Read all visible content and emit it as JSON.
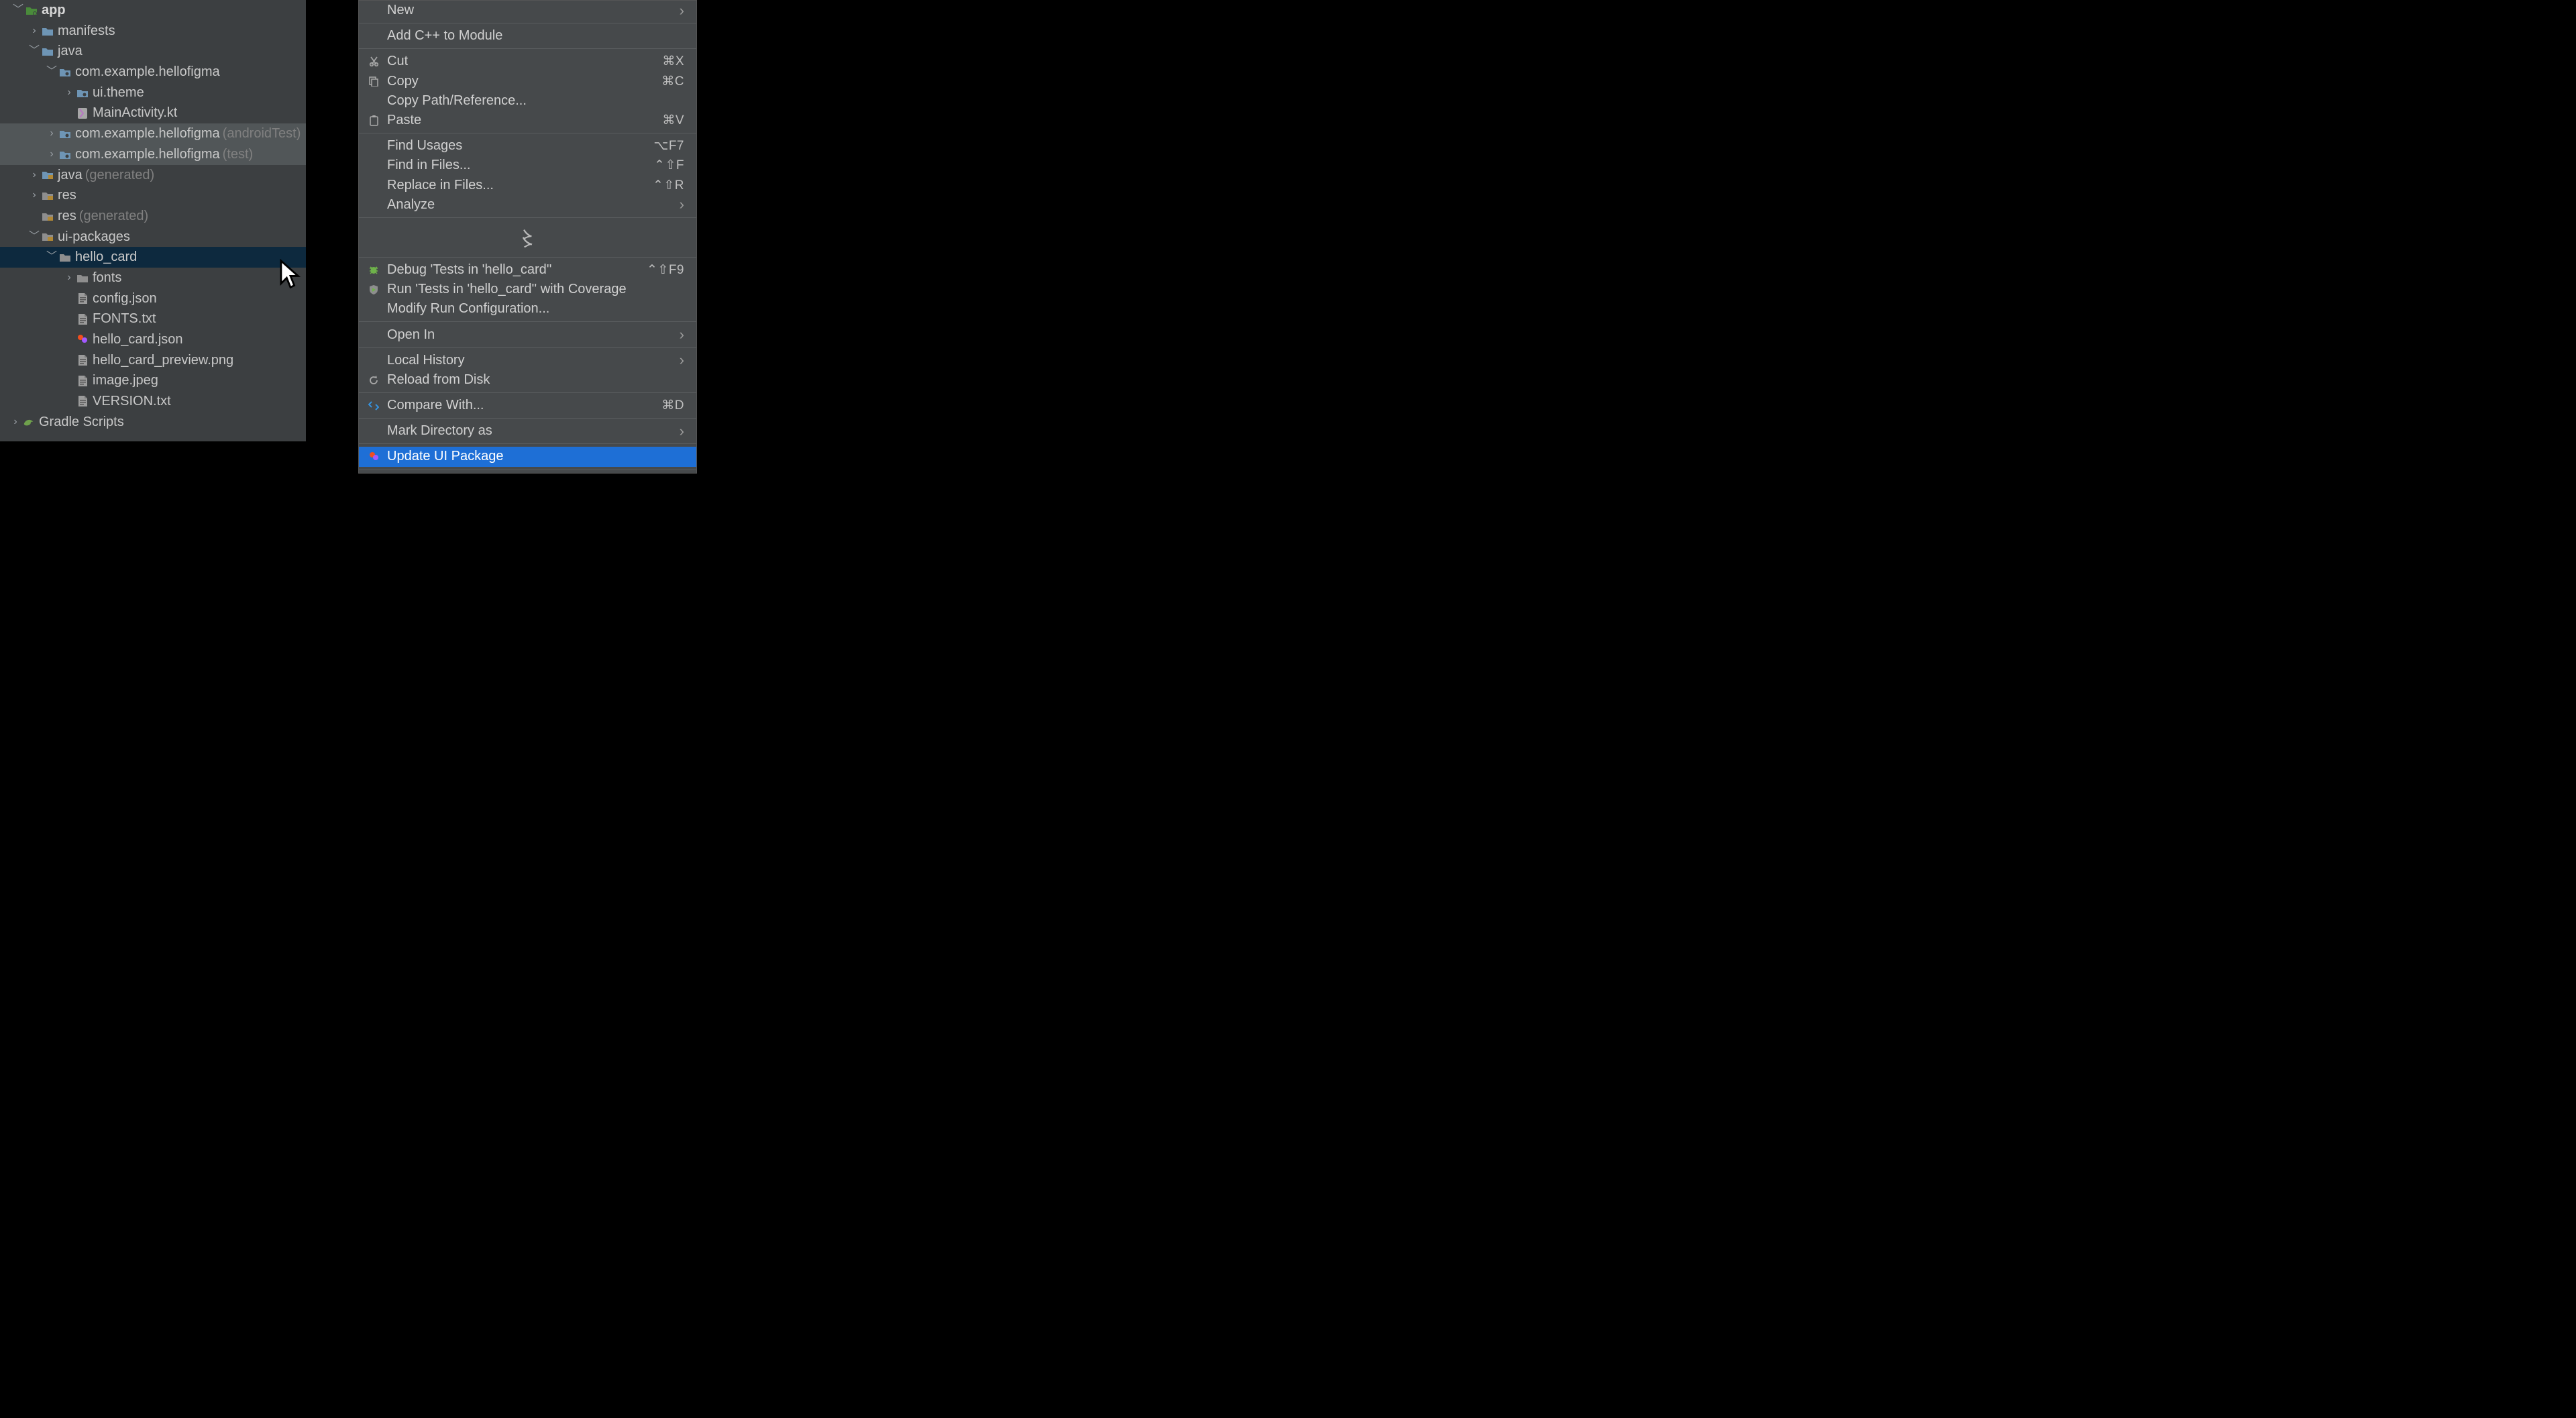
{
  "tree": {
    "rows": [
      {
        "indent": 16,
        "arrow": "down",
        "icon": "module",
        "label": "app",
        "bold": true
      },
      {
        "indent": 40,
        "arrow": "right",
        "icon": "folder",
        "label": "manifests"
      },
      {
        "indent": 40,
        "arrow": "down",
        "icon": "folder",
        "label": "java"
      },
      {
        "indent": 66,
        "arrow": "down",
        "icon": "package",
        "label": "com.example.hellofigma"
      },
      {
        "indent": 92,
        "arrow": "right",
        "icon": "package",
        "label": "ui.theme"
      },
      {
        "indent": 92,
        "arrow": "none",
        "icon": "kt",
        "label": "MainActivity.kt"
      },
      {
        "indent": 66,
        "arrow": "right",
        "icon": "package",
        "label": "com.example.hellofigma",
        "suffix": "(androidTest)",
        "dim": true
      },
      {
        "indent": 66,
        "arrow": "right",
        "icon": "package",
        "label": "com.example.hellofigma",
        "suffix": "(test)",
        "dim": true
      },
      {
        "indent": 40,
        "arrow": "right",
        "icon": "gen-folder",
        "label": "java",
        "suffix": "(generated)"
      },
      {
        "indent": 40,
        "arrow": "right",
        "icon": "res-folder",
        "label": "res"
      },
      {
        "indent": 40,
        "arrow": "none",
        "icon": "res-folder",
        "label": "res",
        "suffix": "(generated)"
      },
      {
        "indent": 40,
        "arrow": "down",
        "icon": "res-folder",
        "label": "ui-packages"
      },
      {
        "indent": 66,
        "arrow": "down",
        "icon": "folder-grey",
        "label": "hello_card",
        "selected": true
      },
      {
        "indent": 92,
        "arrow": "right",
        "icon": "folder-grey",
        "label": "fonts"
      },
      {
        "indent": 92,
        "arrow": "none",
        "icon": "file",
        "label": "config.json"
      },
      {
        "indent": 92,
        "arrow": "none",
        "icon": "file",
        "label": "FONTS.txt"
      },
      {
        "indent": 92,
        "arrow": "none",
        "icon": "figma",
        "label": "hello_card.json"
      },
      {
        "indent": 92,
        "arrow": "none",
        "icon": "file",
        "label": "hello_card_preview.png"
      },
      {
        "indent": 92,
        "arrow": "none",
        "icon": "file",
        "label": "image.jpeg"
      },
      {
        "indent": 92,
        "arrow": "none",
        "icon": "file",
        "label": "VERSION.txt"
      },
      {
        "indent": 12,
        "arrow": "right",
        "icon": "gradle",
        "label": "Gradle Scripts"
      }
    ]
  },
  "menu": {
    "groups": [
      [
        {
          "label": "New",
          "submenu": true
        }
      ],
      [
        {
          "label": "Add C++ to Module"
        }
      ],
      [
        {
          "icon": "cut",
          "label": "Cut",
          "shortcut": "⌘X"
        },
        {
          "icon": "copy",
          "label": "Copy",
          "shortcut": "⌘C"
        },
        {
          "label": "Copy Path/Reference..."
        },
        {
          "icon": "paste",
          "label": "Paste",
          "shortcut": "⌘V"
        }
      ],
      [
        {
          "label": "Find Usages",
          "shortcut": "⌥F7"
        },
        {
          "label": "Find in Files...",
          "shortcut": "⌃⇧F"
        },
        {
          "label": "Replace in Files...",
          "shortcut": "⌃⇧R"
        },
        {
          "label": "Analyze",
          "submenu": true
        }
      ],
      "ellipsis",
      [
        {
          "icon": "bug",
          "label": "Debug 'Tests in 'hello_card''",
          "shortcut": "⌃⇧F9"
        },
        {
          "icon": "coverage",
          "label": "Run 'Tests in 'hello_card'' with Coverage"
        },
        {
          "label": "Modify Run Configuration..."
        }
      ],
      [
        {
          "label": "Open In",
          "submenu": true
        }
      ],
      [
        {
          "label": "Local History",
          "submenu": true
        },
        {
          "icon": "reload",
          "label": "Reload from Disk"
        }
      ],
      [
        {
          "icon": "compare",
          "label": "Compare With...",
          "shortcut": "⌘D"
        }
      ],
      [
        {
          "label": "Mark Directory as",
          "submenu": true
        }
      ],
      [
        {
          "icon": "update",
          "label": "Update UI Package",
          "highlight": true
        }
      ]
    ]
  }
}
